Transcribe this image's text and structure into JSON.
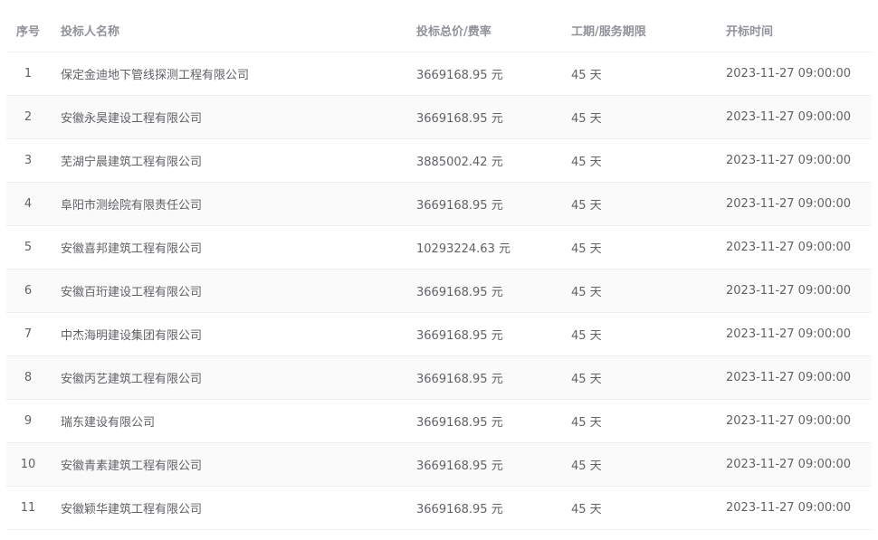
{
  "table": {
    "headers": {
      "index": "序号",
      "bidder": "投标人名称",
      "price": "投标总价/费率",
      "period": "工期/服务期限",
      "open_time": "开标时间"
    },
    "rows": [
      {
        "index": "1",
        "bidder": "保定金迪地下管线探测工程有限公司",
        "price": "3669168.95 元",
        "period": "45 天",
        "open_time": "2023-11-27 09:00:00"
      },
      {
        "index": "2",
        "bidder": "安徽永昊建设工程有限公司",
        "price": "3669168.95 元",
        "period": "45 天",
        "open_time": "2023-11-27 09:00:00"
      },
      {
        "index": "3",
        "bidder": "芜湖宁晨建筑工程有限公司",
        "price": "3885002.42 元",
        "period": "45 天",
        "open_time": "2023-11-27 09:00:00"
      },
      {
        "index": "4",
        "bidder": "阜阳市测绘院有限责任公司",
        "price": "3669168.95 元",
        "period": "45 天",
        "open_time": "2023-11-27 09:00:00"
      },
      {
        "index": "5",
        "bidder": "安徽喜邦建筑工程有限公司",
        "price": "10293224.63 元",
        "period": "45 天",
        "open_time": "2023-11-27 09:00:00"
      },
      {
        "index": "6",
        "bidder": "安徽百珩建设工程有限公司",
        "price": "3669168.95 元",
        "period": "45 天",
        "open_time": "2023-11-27 09:00:00"
      },
      {
        "index": "7",
        "bidder": "中杰海明建设集团有限公司",
        "price": "3669168.95 元",
        "period": "45 天",
        "open_time": "2023-11-27 09:00:00"
      },
      {
        "index": "8",
        "bidder": "安徽丙艺建筑工程有限公司",
        "price": "3669168.95 元",
        "period": "45 天",
        "open_time": "2023-11-27 09:00:00"
      },
      {
        "index": "9",
        "bidder": "瑞东建设有限公司",
        "price": "3669168.95 元",
        "period": "45 天",
        "open_time": "2023-11-27 09:00:00"
      },
      {
        "index": "10",
        "bidder": "安徽青素建筑工程有限公司",
        "price": "3669168.95 元",
        "period": "45 天",
        "open_time": "2023-11-27 09:00:00"
      },
      {
        "index": "11",
        "bidder": "安徽颖华建筑工程有限公司",
        "price": "3669168.95 元",
        "period": "45 天",
        "open_time": "2023-11-27 09:00:00"
      }
    ]
  },
  "colors": {
    "header_text": "#909399",
    "body_text": "#606266",
    "border": "#ebeef5",
    "stripe": "#fafafa"
  }
}
